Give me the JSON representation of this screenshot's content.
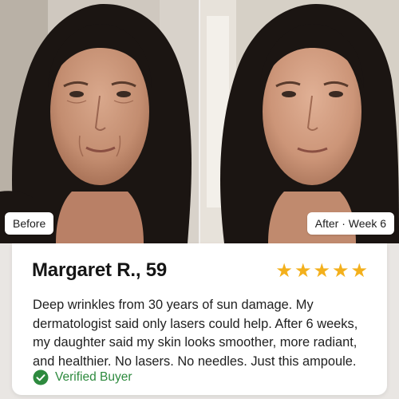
{
  "photos": {
    "before_label": "Before",
    "after_label": "After · Week 6"
  },
  "review": {
    "name": "Margaret R., 59",
    "rating": 5,
    "star_color": "#f3b01c",
    "text": "Deep wrinkles from 30 years of sun damage. My dermatologist said only lasers could help. After 6 weeks, my daughter said my skin looks smoother, more radiant, and healthier. No lasers. No needles. Just this ampoule.",
    "verified_label": "Verified Buyer",
    "verified_color": "#2d8a3e",
    "verified_icon": "check-circle-icon"
  }
}
